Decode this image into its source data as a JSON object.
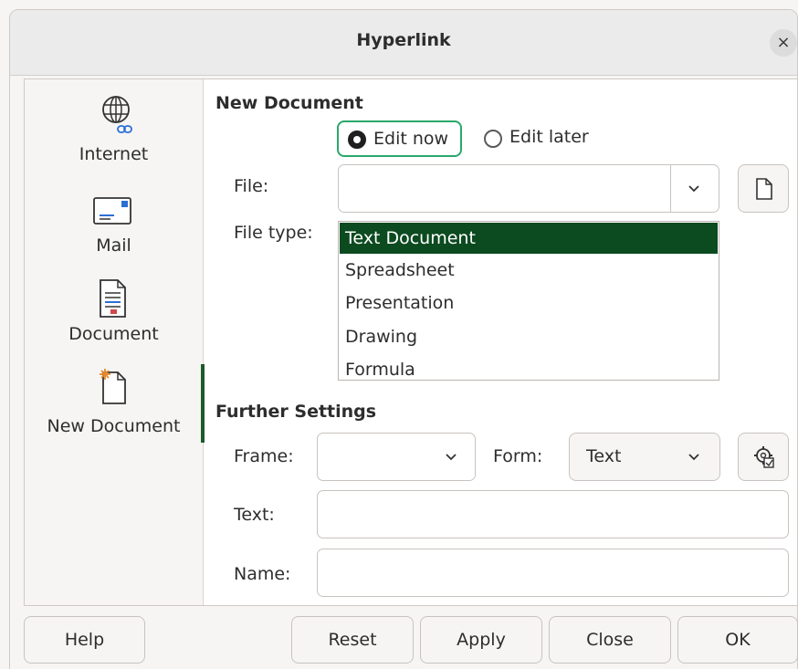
{
  "window": {
    "title": "Hyperlink",
    "close_symbol": "×"
  },
  "sidebar": {
    "items": [
      {
        "label": "Internet",
        "icon": "globe-link-icon"
      },
      {
        "label": "Mail",
        "icon": "envelope-icon"
      },
      {
        "label": "Document",
        "icon": "document-icon"
      },
      {
        "label": "New Document",
        "icon": "new-document-icon",
        "active": true
      }
    ]
  },
  "new_document": {
    "heading": "New Document",
    "edit_now_label": "Edit now",
    "edit_later_label": "Edit later",
    "selected_mode": "Edit now",
    "file_label": "File:",
    "file_value": "",
    "file_type_label": "File type:",
    "file_types": [
      "Text Document",
      "Spreadsheet",
      "Presentation",
      "Drawing",
      "Formula"
    ],
    "selected_file_type": "Text Document"
  },
  "further_settings": {
    "heading": "Further Settings",
    "frame_label": "Frame:",
    "frame_value": "",
    "form_label": "Form:",
    "form_value": "Text",
    "text_label": "Text:",
    "text_value": "",
    "name_label": "Name:",
    "name_value": ""
  },
  "buttons": {
    "help": "Help",
    "reset": "Reset",
    "apply": "Apply",
    "close": "Close",
    "ok": "OK"
  },
  "colors": {
    "selection": "#0c4a20",
    "focus_ring": "#2aa86b",
    "active_tab_bar": "#1c5a2d"
  }
}
